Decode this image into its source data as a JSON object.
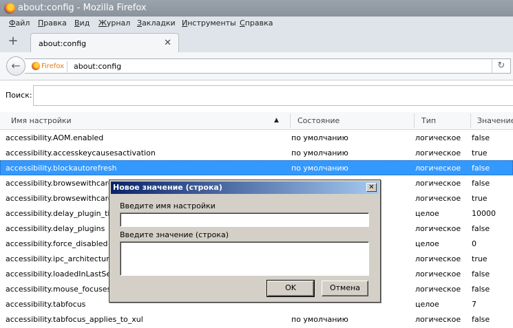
{
  "window": {
    "title": "about:config - Mozilla Firefox"
  },
  "menubar": [
    {
      "underline": "Ф",
      "rest": "айл"
    },
    {
      "underline": "П",
      "rest": "равка"
    },
    {
      "underline": "В",
      "rest": "ид"
    },
    {
      "underline": "Ж",
      "rest": "урнал"
    },
    {
      "underline": "З",
      "rest": "акладки"
    },
    {
      "underline": "И",
      "rest": "нструменты"
    },
    {
      "underline": "С",
      "rest": "правка"
    }
  ],
  "tab": {
    "title": "about:config",
    "close_glyph": "✕"
  },
  "newtab_glyph": "+",
  "nav": {
    "identity_label": "Firefox",
    "url": "about:config",
    "back_glyph": "←",
    "reload_glyph": "↻"
  },
  "search": {
    "label": "Поиск:",
    "value": ""
  },
  "columns": {
    "name": "Имя настройки",
    "status": "Состояние",
    "type": "Тип",
    "value": "Значение"
  },
  "rows": [
    {
      "name": "accessibility.AOM.enabled",
      "status": "по умолчанию",
      "type": "логическое",
      "value": "false"
    },
    {
      "name": "accessibility.accesskeycausesactivation",
      "status": "по умолчанию",
      "type": "логическое",
      "value": "true"
    },
    {
      "name": "accessibility.blockautorefresh",
      "status": "по умолчанию",
      "type": "логическое",
      "value": "false",
      "selected": true
    },
    {
      "name": "accessibility.browsewithcaret",
      "status": "",
      "type": "логическое",
      "value": "false"
    },
    {
      "name": "accessibility.browsewithcaret_s",
      "status": "",
      "type": "логическое",
      "value": "true"
    },
    {
      "name": "accessibility.delay_plugin_time",
      "status": "",
      "type": "целое",
      "value": "10000"
    },
    {
      "name": "accessibility.delay_plugins",
      "status": "",
      "type": "логическое",
      "value": "false"
    },
    {
      "name": "accessibility.force_disabled",
      "status": "",
      "type": "целое",
      "value": "0"
    },
    {
      "name": "accessibility.ipc_architecture.e",
      "status": "",
      "type": "логическое",
      "value": "true"
    },
    {
      "name": "accessibility.loadedInLastSessi",
      "status": "",
      "type": "логическое",
      "value": "false"
    },
    {
      "name": "accessibility.mouse_focuses_fo",
      "status": "",
      "type": "логическое",
      "value": "false"
    },
    {
      "name": "accessibility.tabfocus",
      "status": "",
      "type": "целое",
      "value": "7"
    },
    {
      "name": "accessibility.tabfocus_applies_to_xul",
      "status": "по умолчанию",
      "type": "логическое",
      "value": "false"
    }
  ],
  "dialog": {
    "title": "Новое значение (строка)",
    "close_glyph": "✕",
    "name_label": "Введите имя настройки",
    "name_value": "",
    "value_label": "Введите значение (строка)",
    "value_value": "",
    "ok": "OK",
    "cancel": "Отмена"
  }
}
